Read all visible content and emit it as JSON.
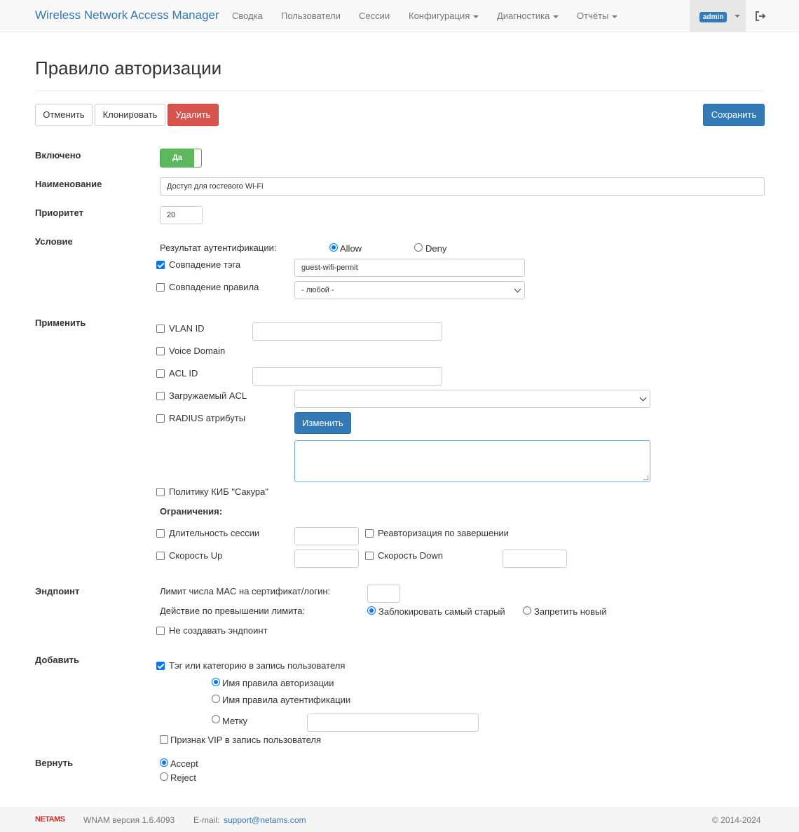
{
  "navbar": {
    "brand": "Wireless Network Access Manager",
    "items": [
      "Сводка",
      "Пользователи",
      "Сессии",
      "Конфигурация",
      "Диагностика",
      "Отчёты"
    ],
    "user": "admin"
  },
  "page": {
    "title": "Правило авторизации"
  },
  "toolbar": {
    "cancel": "Отменить",
    "clone": "Клонировать",
    "delete": "Удалить",
    "save": "Сохранить"
  },
  "form": {
    "enabled_label": "Включено",
    "enabled_value": "Да",
    "name_label": "Наименование",
    "name_value": "Доступ для гостевого Wi-Fi",
    "priority_label": "Приоритет",
    "priority_value": "20",
    "condition": {
      "label": "Условие",
      "auth_result_label": "Результат аутентификации:",
      "allow": "Allow",
      "deny": "Deny",
      "tag_match": "Совпадение тэга",
      "tag_value": "guest-wifi-permit",
      "rule_match": "Совпадение правила",
      "rule_select": "- любой -"
    },
    "apply": {
      "label": "Применить",
      "vlan_id": "VLAN ID",
      "voice_domain": "Voice Domain",
      "acl_id": "ACL ID",
      "dacl": "Загружаемый ACL",
      "radius": "RADIUS атрибуты",
      "edit_button": "Изменить",
      "policy": "Политику КИБ \"Сакура\"",
      "limits_label": "Ограничения:",
      "session_duration": "Длительность сессии",
      "reauth": "Реавторизация по завершении",
      "speed_up": "Скорость Up",
      "speed_down": "Скорость Down"
    },
    "endpoint": {
      "label": "Эндпоинт",
      "mac_limit": "Лимит числа MAC на сертификат/логин:",
      "action_label": "Действие по превышении лимита:",
      "block_oldest": "Заблокировать самый старый",
      "deny_new": "Запретить новый",
      "no_create": "Не создавать эндпоинт"
    },
    "add": {
      "label": "Добавить",
      "tag_or_category": "Тэг или категорию в запись пользователя",
      "authz_rule_name": "Имя правила авторизации",
      "authn_rule_name": "Имя правила аутентификации",
      "mark": "Метку",
      "vip": "Признак VIP в запись пользователя"
    },
    "return": {
      "label": "Вернуть",
      "accept": "Accept",
      "reject": "Reject"
    }
  },
  "footer": {
    "logo": "NETAMS",
    "version": "WNAM версия 1.6.4093",
    "email_label": "E-mail:",
    "email": "support@netams.com",
    "copyright": "© 2014-2024"
  }
}
